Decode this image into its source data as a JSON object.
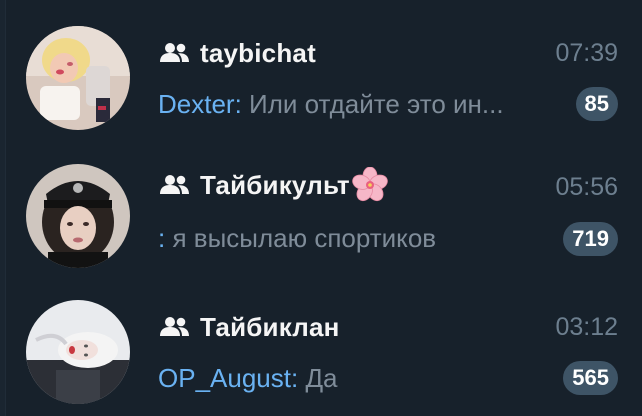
{
  "chats": [
    {
      "title": "taybichat",
      "time": "07:39",
      "sender": "Dexter:",
      "message": "Или отдайте это ин...",
      "unread": "85",
      "is_group": true
    },
    {
      "title": "Тайбикульт",
      "title_emoji": "cherry-blossom-icon",
      "time": "05:56",
      "sender": ":",
      "message": "я высылаю спортиков",
      "unread": "719",
      "is_group": true
    },
    {
      "title": "Тайбиклан",
      "time": "03:12",
      "sender": "OP_August:",
      "message": "Да",
      "unread": "565",
      "is_group": true
    }
  ],
  "colors": {
    "background": "#17212b",
    "title": "#f5f5f5",
    "time": "#6d7f8f",
    "sender": "#6ab2f2",
    "message": "#7f8c99",
    "badge": "#3e5466"
  }
}
